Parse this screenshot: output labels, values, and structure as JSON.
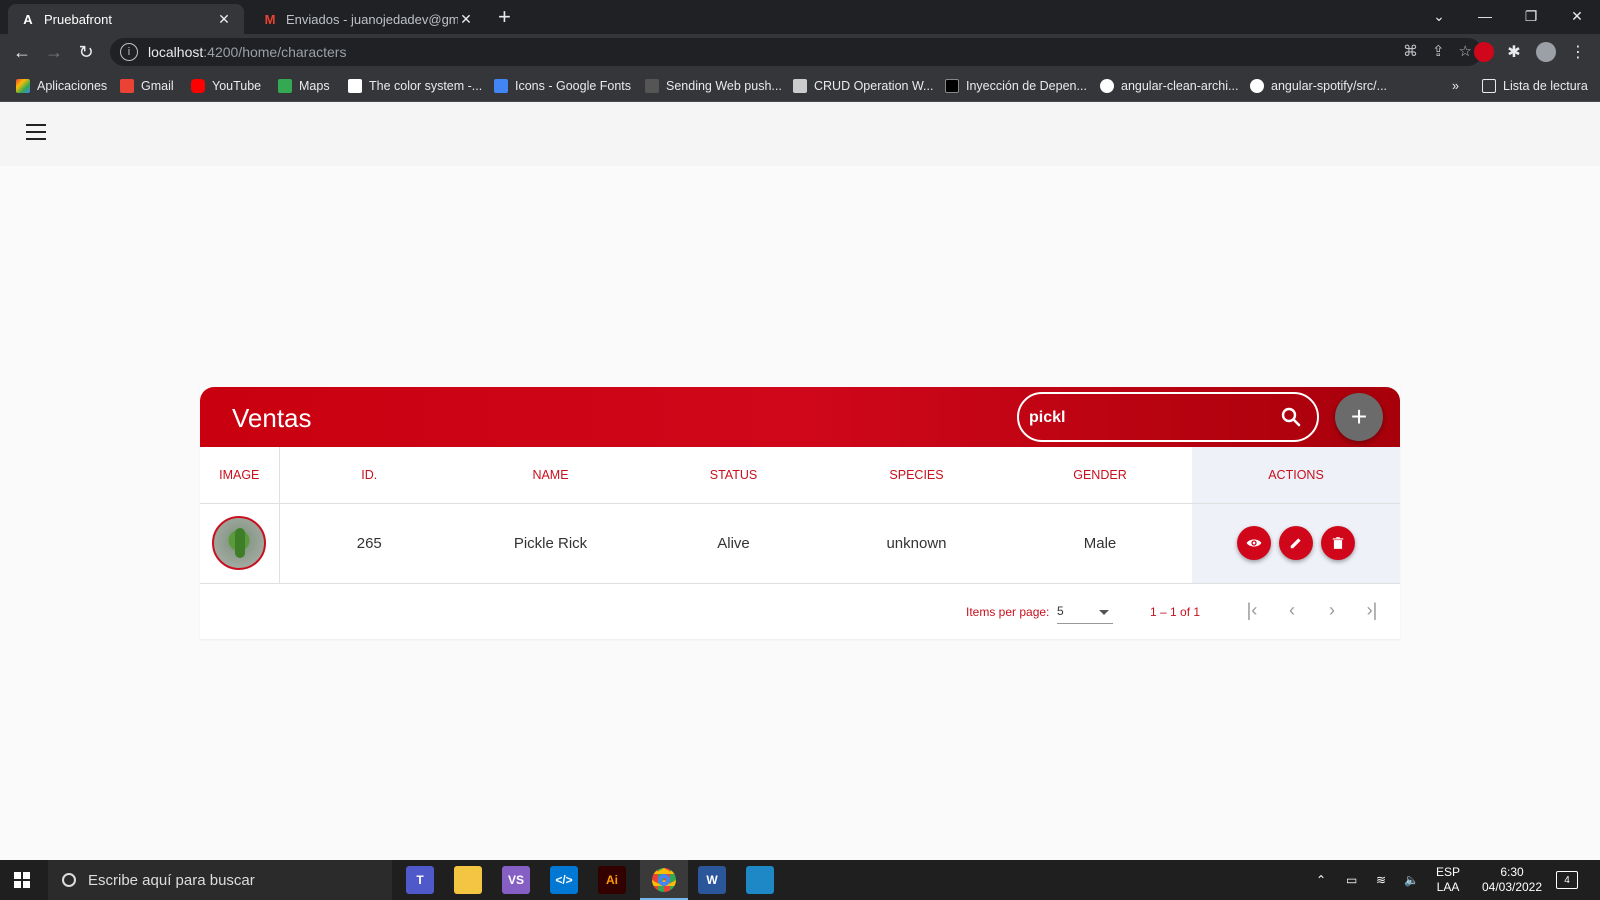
{
  "browser": {
    "tabs": [
      {
        "title": "Pruebafront",
        "icon": "A",
        "active": true
      },
      {
        "title": "Enviados - juanojedadev@gmail.",
        "icon": "M",
        "active": false
      }
    ],
    "url_host": "localhost",
    "url_path": ":4200/home/characters",
    "bookmarks": [
      {
        "label": "Aplicaciones",
        "color": "#e8453c"
      },
      {
        "label": "Gmail",
        "color": "#ea4335"
      },
      {
        "label": "YouTube",
        "color": "#ff0000"
      },
      {
        "label": "Maps",
        "color": "#34a853"
      },
      {
        "label": "The color system -...",
        "color": "#ffffff"
      },
      {
        "label": "Icons - Google Fonts",
        "color": "#4285f4"
      },
      {
        "label": "Sending Web push...",
        "color": "#555555"
      },
      {
        "label": "CRUD Operation W...",
        "color": "#cccccc"
      },
      {
        "label": "Inyección de Depen...",
        "color": "#000000"
      },
      {
        "label": "angular-clean-archi...",
        "color": "#ffffff"
      },
      {
        "label": "angular-spotify/src/...",
        "color": "#ffffff"
      }
    ],
    "reading_list": "Lista de lectura",
    "more_bookmarks": "»"
  },
  "app": {
    "card_title": "Ventas",
    "search": {
      "value": "pickl"
    },
    "add_label": "+",
    "table": {
      "headers": [
        "IMAGE",
        "ID.",
        "NAME",
        "STATUS",
        "SPECIES",
        "GENDER",
        "ACTIONS"
      ],
      "rows": [
        {
          "id": "265",
          "name": "Pickle Rick",
          "status": "Alive",
          "species": "unknown",
          "gender": "Male"
        }
      ]
    },
    "paginator": {
      "items_per_page_label": "Items per page:",
      "page_size": "5",
      "range": "1 – 1 of 1"
    }
  },
  "taskbar": {
    "search_placeholder": "Escribe aquí para buscar",
    "lang": "ESP",
    "lang_sub": "LAA",
    "time": "6:30",
    "date": "04/03/2022",
    "notifications": "4"
  },
  "colors": {
    "brand_red": "#d0071a",
    "header_text": "#c8101e",
    "actions_bg": "#eef1f8"
  }
}
